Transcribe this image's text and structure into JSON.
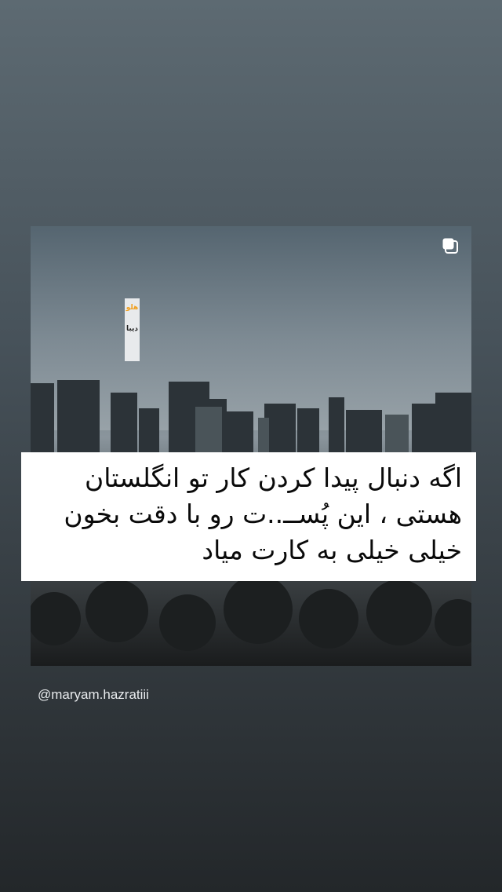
{
  "post": {
    "sticker_line1": "هلو",
    "sticker_line2": "دیبا",
    "caption_lines": [
      "اگه دنبال پیدا کردن کار تو انگلستان",
      "هستی ، این پُســ..ت رو با دقت بخون",
      "خیلی خیلی به کارت میاد"
    ],
    "icons": {
      "multiple_posts": "multiple-posts-icon"
    }
  },
  "username": "@maryam.hazratiii"
}
